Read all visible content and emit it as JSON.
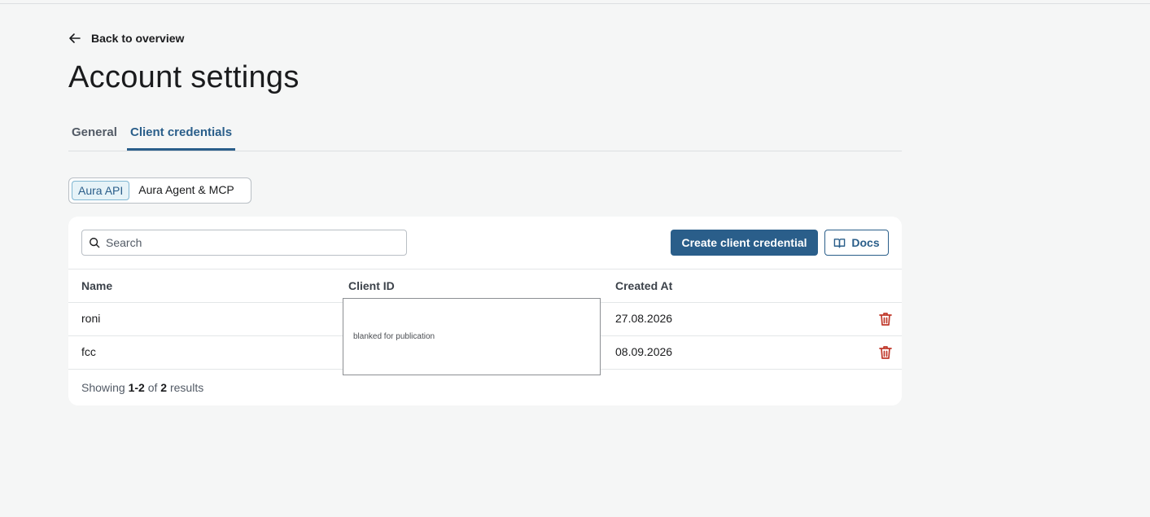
{
  "nav": {
    "back_label": "Back to overview"
  },
  "page": {
    "title": "Account settings"
  },
  "tabs": [
    {
      "label": "General",
      "active": false
    },
    {
      "label": "Client credentials",
      "active": true
    }
  ],
  "segment": {
    "options": [
      {
        "label": "Aura API",
        "active": true
      },
      {
        "label": "Aura Agent & MCP",
        "active": false
      }
    ]
  },
  "toolbar": {
    "search_placeholder": "Search",
    "search_value": "",
    "create_label": "Create client credential",
    "docs_label": "Docs"
  },
  "table": {
    "columns": [
      "Name",
      "Client ID",
      "Created At"
    ],
    "rows": [
      {
        "name": "roni",
        "client_id": "",
        "created_at": "27.08.2026"
      },
      {
        "name": "fcc",
        "client_id": "",
        "created_at": "08.09.2026"
      }
    ]
  },
  "pagination": {
    "prefix": "Showing",
    "range": "1-2",
    "of": "of",
    "total": "2",
    "suffix": "results"
  },
  "redaction": {
    "label": "blanked for publication"
  },
  "colors": {
    "accent": "#2a5e8a",
    "danger": "#c0392b",
    "background": "#f5f6f6"
  }
}
